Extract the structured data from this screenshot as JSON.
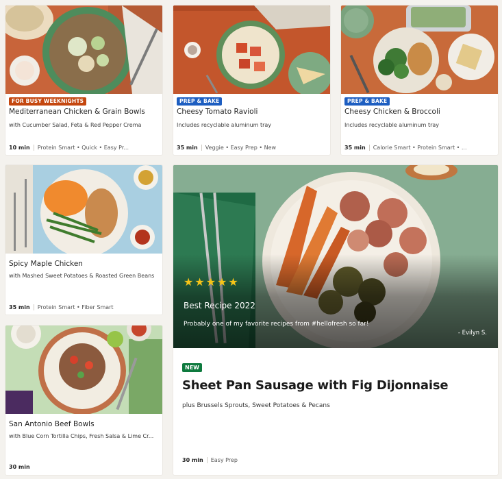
{
  "cards": [
    {
      "badge": "FOR BUSY WEEKNIGHTS",
      "title": "Mediterranean Chicken & Grain Bowls",
      "subtitle": "with Cucumber Salad, Feta & Red Pepper Crema",
      "time": "10 min",
      "tags": "Protein Smart • Quick • Easy Pr..."
    },
    {
      "badge": "PREP & BAKE",
      "title": "Cheesy Tomato Ravioli",
      "subtitle": "Includes recyclable aluminum tray",
      "time": "35 min",
      "tags": "Veggie • Easy Prep • New"
    },
    {
      "badge": "PREP & BAKE",
      "title": "Cheesy Chicken & Broccoli",
      "subtitle": "Includes recyclable aluminum tray",
      "time": "35 min",
      "tags": "Calorie Smart • Protein Smart • ..."
    },
    {
      "title": "Spicy Maple Chicken",
      "subtitle": "with Mashed Sweet Potatoes & Roasted Green Beans",
      "time": "35 min",
      "tags": "Protein Smart • Fiber Smart"
    },
    {
      "title": "San Antonio Beef Bowls",
      "subtitle": "with Blue Corn Tortilla Chips, Fresh Salsa & Lime Cr...",
      "time": "30 min",
      "tags": ""
    }
  ],
  "featured": {
    "rating_stars": 5,
    "review_title": "Best Recipe 2022",
    "review_quote": "Probably one of my favorite recipes from #hellofresh so far!",
    "review_author": "- Evilyn S.",
    "badge": "NEW",
    "title": "Sheet Pan Sausage with Fig Dijonnaise",
    "subtitle": "plus Brussels Sprouts, Sweet Potatoes & Pecans",
    "time": "30 min",
    "tags": "Easy Prep"
  },
  "colors": {
    "badge_orange": "#c4470f",
    "badge_blue": "#1d5ec1",
    "badge_green": "#0e7a3e",
    "star": "#f6c418",
    "page_bg": "#f4f2ee"
  }
}
